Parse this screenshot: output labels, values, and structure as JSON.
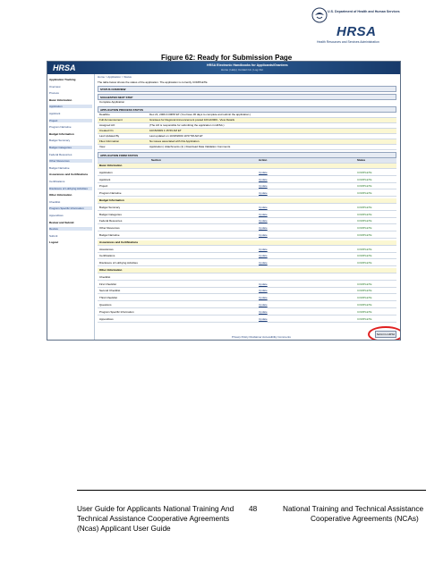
{
  "logo": {
    "hhs_line1": "U.S. Department of Health and Human Services",
    "hhs_line2": "Health Resources and Services Administration",
    "hrsa": "HRSA"
  },
  "figure_title": "Figure 62: Ready for Submission Page",
  "screenshot": {
    "header_logo": "HRSA",
    "header_title": "HRSA Electronic Handbooks for Applicants/Grantees",
    "header_links": "Home  |  Help  |  Contact Us  |  Log Out",
    "sidebar": [
      {
        "label": "Application Tracking",
        "type": "head"
      },
      {
        "label": "Overview",
        "type": "item"
      },
      {
        "label": "Process",
        "type": "item"
      },
      {
        "label": "Basic Information",
        "type": "head"
      },
      {
        "label": "Application",
        "type": "hl"
      },
      {
        "label": "Applicant",
        "type": "item"
      },
      {
        "label": "Project",
        "type": "hl"
      },
      {
        "label": "Program Narrative",
        "type": "item"
      },
      {
        "label": "Budget Information",
        "type": "head"
      },
      {
        "label": "Budget Summary",
        "type": "item"
      },
      {
        "label": "Budget Categories",
        "type": "hl"
      },
      {
        "label": "Federal Resources",
        "type": "item"
      },
      {
        "label": "Other Resources",
        "type": "hl"
      },
      {
        "label": "Budget Narrative",
        "type": "item"
      },
      {
        "label": "Assurances and Certifications",
        "type": "head"
      },
      {
        "label": "Certifications",
        "type": "item"
      },
      {
        "label": "Disclosure of Lobbying Activities",
        "type": "hl"
      },
      {
        "label": "Other Information",
        "type": "head"
      },
      {
        "label": "Checklist",
        "type": "item"
      },
      {
        "label": "Program Specific Information",
        "type": "hl"
      },
      {
        "label": "Appendices",
        "type": "item"
      },
      {
        "label": "Review and Submit",
        "type": "head"
      },
      {
        "label": "Review",
        "type": "hl"
      },
      {
        "label": "Submit",
        "type": "item"
      },
      {
        "label": "Logout",
        "type": "head"
      }
    ],
    "main": {
      "breadcrumb": "Home > Application > Status",
      "intro": "The table below shows the status of the application. The application is currently COMPLETE.",
      "status_overview": "STATUS OVERVIEW",
      "suggested_next_step_label": "SUGGESTED NEXT STEP",
      "suggested_next_step": "Complete Application",
      "process_status_label": "APPLICATION PROCESS STATUS",
      "process_rows": [
        {
          "k": "Deadline",
          "v": "Dec 21, 2009 4:00PM ET  (You have 36 days to complete and submit the application.)"
        },
        {
          "k": "Full Announcement",
          "v": "Grantees for Regional Announcement posted 10/12/2009 - View Details"
        },
        {
          "k": "Assigned AO",
          "v": "(The AO is responsible for submitting the application in HRSA.)"
        },
        {
          "k": "Created On",
          "v": "10/15/2009 1:15:56 AM ET"
        },
        {
          "k": "Last Updated By",
          "v": "Last updated on 10/18/2009 10:57:58 AM ET"
        },
        {
          "k": "Files Information",
          "v": "No issues associated with this Application."
        },
        {
          "k": "View",
          "v": "Application | Attachments (1) | Download Data Validation Comments"
        }
      ],
      "form_status_label": "APPLICATION FORM STATUS",
      "columns": [
        "Section",
        "Action",
        "Status"
      ],
      "form_rows": [
        {
          "s": "Basic Information",
          "a": "",
          "st": "",
          "group": true
        },
        {
          "s": "Application",
          "a": "Update",
          "st": "COMPLETE"
        },
        {
          "s": "Applicant",
          "a": "Update",
          "st": "COMPLETE"
        },
        {
          "s": "Project",
          "a": "Update",
          "st": "COMPLETE"
        },
        {
          "s": "Program Narrative",
          "a": "Update",
          "st": "COMPLETE"
        },
        {
          "s": "Budget Information",
          "a": "",
          "st": "",
          "group": true
        },
        {
          "s": "Budget Summary",
          "a": "Update",
          "st": "COMPLETE"
        },
        {
          "s": "Budget Categories",
          "a": "Update",
          "st": "COMPLETE"
        },
        {
          "s": "Federal Resources",
          "a": "Update",
          "st": "COMPLETE"
        },
        {
          "s": "Other Resources",
          "a": "Update",
          "st": "COMPLETE"
        },
        {
          "s": "Budget Narrative",
          "a": "Update",
          "st": "COMPLETE"
        },
        {
          "s": "Assurances and Certifications",
          "a": "",
          "st": "",
          "group": true
        },
        {
          "s": "Assurances",
          "a": "Update",
          "st": "COMPLETE"
        },
        {
          "s": "Certifications",
          "a": "Update",
          "st": "COMPLETE"
        },
        {
          "s": "Disclosure of Lobbying Activities",
          "a": "Update",
          "st": "COMPLETE"
        },
        {
          "s": "Other Information",
          "a": "",
          "st": "",
          "group": true
        },
        {
          "s": "Checklist",
          "a": "",
          "st": ""
        },
        {
          "s": "  First Checklist",
          "a": "Update",
          "st": "COMPLETE"
        },
        {
          "s": "  Second Checklist",
          "a": "Update",
          "st": "COMPLETE"
        },
        {
          "s": "  Third Checklist",
          "a": "Update",
          "st": "COMPLETE"
        },
        {
          "s": "  Questions",
          "a": "Update",
          "st": "COMPLETE"
        },
        {
          "s": "Program Specific Information",
          "a": "Update",
          "st": "COMPLETE"
        },
        {
          "s": "Appendices",
          "a": "Update",
          "st": "COMPLETE"
        }
      ],
      "submit_label": "Submit to HRSA",
      "footer_links": "Privacy Policy  Disclaimer  Accessibility  Comments"
    }
  },
  "footer": {
    "left_line1": "User Guide for Applicants National Training And",
    "left_line2": "Technical Assistance Cooperative Agreements",
    "left_line3": "(Ncas) Applicant User Guide",
    "page": "48",
    "right_line1": "National Training and Technical Assistance",
    "right_line2": "Cooperative Agreements (NCAs)"
  }
}
